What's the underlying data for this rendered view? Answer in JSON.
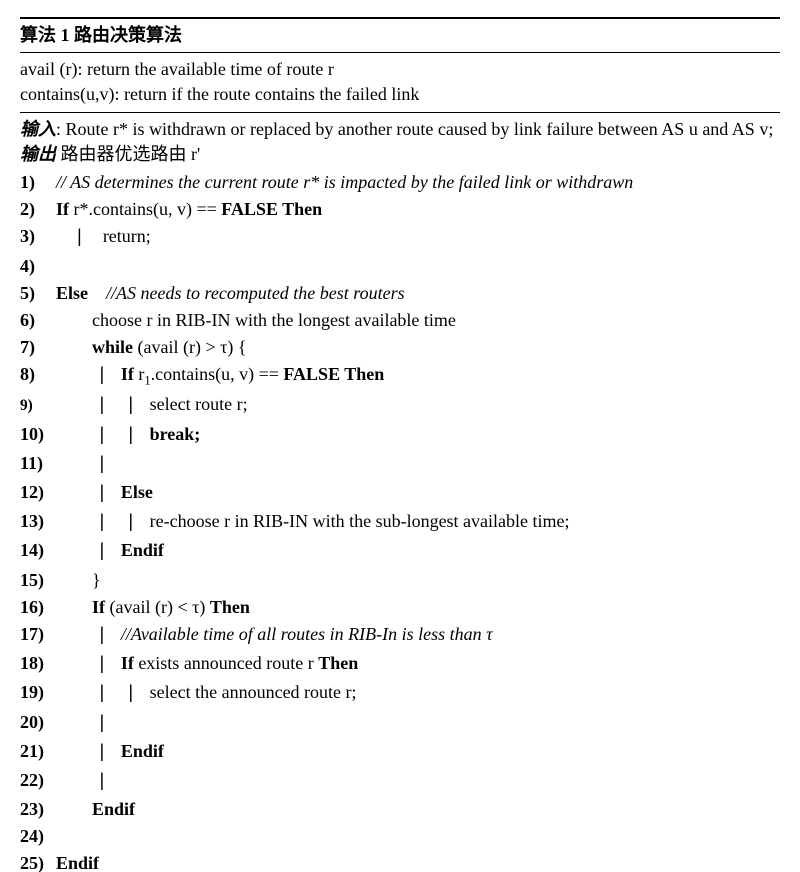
{
  "header": {
    "title_prefix": "算法 1",
    "title": "路由决策算法"
  },
  "defs": {
    "line1": "avail (r): return the available time of route r",
    "line2": "contains(u,v): return if the route contains the failed link"
  },
  "io": {
    "input_label": "输入",
    "input_text": ": Route r* is withdrawn or replaced by another route caused by link failure between AS u and AS v;",
    "output_label": "输出",
    "output_text": " 路由器优选路由 r'"
  },
  "lines": {
    "l1": {
      "n": "1)",
      "comment": "// AS determines the current route r* is impacted by the failed link or withdrawn"
    },
    "l2": {
      "n": "2)",
      "kw_if": "If ",
      "text": "r*.contains(u, v) == ",
      "kw_false": "FALSE",
      "kw_then": " Then"
    },
    "l3": {
      "n": "3)",
      "text": "return;"
    },
    "l4": {
      "n": "4)"
    },
    "l5": {
      "n": "5)",
      "kw_else": "Else",
      "comment": "    //AS needs to recomputed the best routers"
    },
    "l6": {
      "n": "6)",
      "text": "choose r in RIB-IN with the longest available time"
    },
    "l7": {
      "n": "7)",
      "kw_while": "while ",
      "text": "(avail (r) > τ) {"
    },
    "l8": {
      "n": "8)",
      "kw_if": "If ",
      "text_pre": "r",
      "sub": "1",
      "text_post": ".contains(u, v) == ",
      "kw_false": "FALSE",
      "kw_then": " Then"
    },
    "l9": {
      "n": "9)",
      "text": "select route r;"
    },
    "l10": {
      "n": "10)",
      "kw_break": "break;"
    },
    "l11": {
      "n": "11)"
    },
    "l12": {
      "n": "12)",
      "kw_else": "Else"
    },
    "l13": {
      "n": "13)",
      "text": "re-choose r in RIB-IN with the sub-longest available time;"
    },
    "l14": {
      "n": "14)",
      "kw_endif": "Endif"
    },
    "l15": {
      "n": "15)",
      "text": "}"
    },
    "l16": {
      "n": "16)",
      "kw_if": "If ",
      "text": "(avail (r) < τ) ",
      "kw_then": "Then"
    },
    "l17": {
      "n": "17)",
      "comment": "//Available time of all routes in RIB-In is less than τ"
    },
    "l18": {
      "n": "18)",
      "kw_if": "If ",
      "text": "exists announced route r ",
      "kw_then": "Then"
    },
    "l19": {
      "n": "19)",
      "text": "select the announced route r;"
    },
    "l20": {
      "n": "20)"
    },
    "l21": {
      "n": "21)",
      "kw_endif": "Endif"
    },
    "l22": {
      "n": "22)"
    },
    "l23": {
      "n": "23)",
      "kw_endif": "Endif"
    },
    "l24": {
      "n": "24)"
    },
    "l25": {
      "n": "25)",
      "kw_endif": "Endif"
    }
  }
}
